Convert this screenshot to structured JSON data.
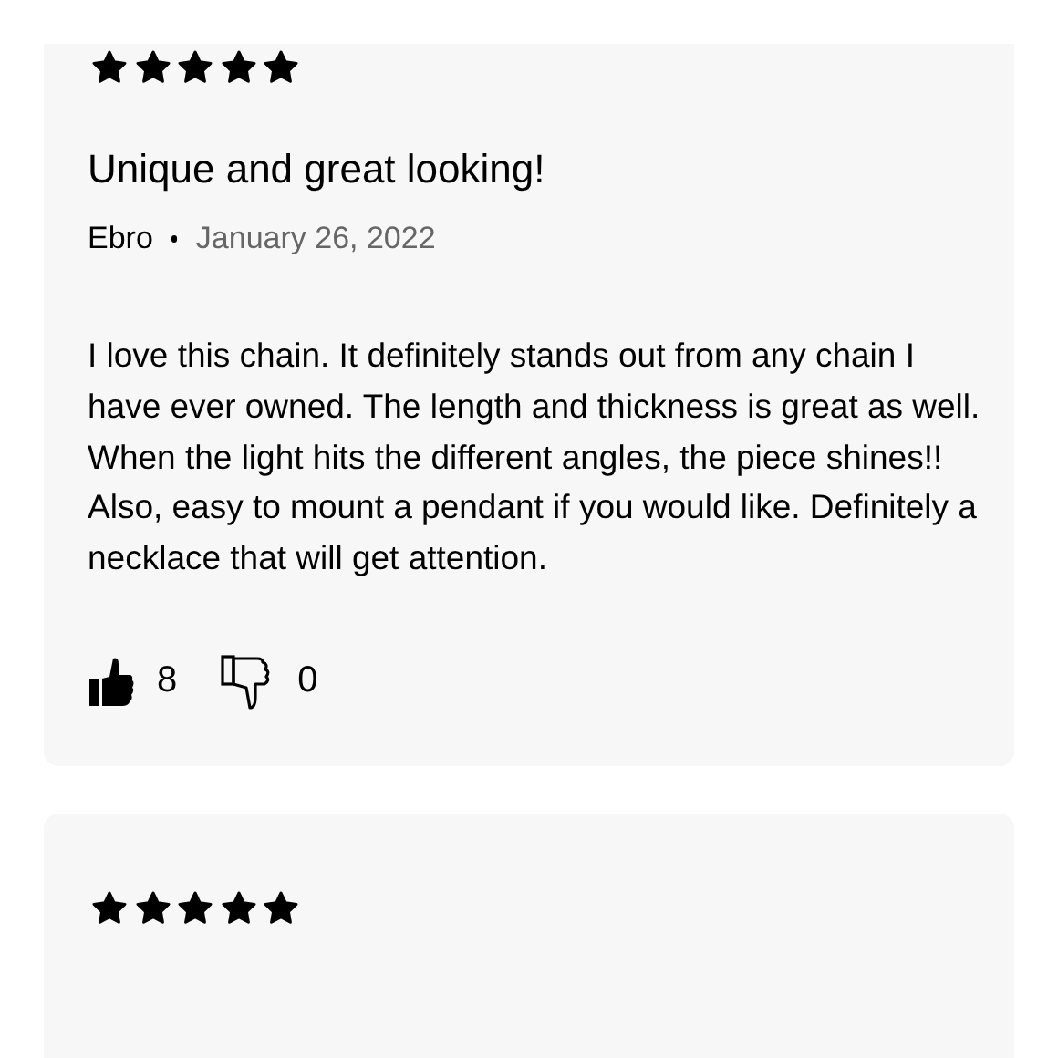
{
  "reviews": [
    {
      "stars": 5,
      "title": "Unique and great looking!",
      "author": "Ebro",
      "date": "January 26, 2022",
      "body": "I love this chain. It definitely stands out from any chain I have ever owned. The length and thickness is great as well. When the light hits the different angles, the piece shines!! Also, easy to mount a pendant if you would like. Definitely a necklace that will get attention.",
      "likes": "8",
      "dislikes": "0"
    },
    {
      "stars": 5
    }
  ]
}
